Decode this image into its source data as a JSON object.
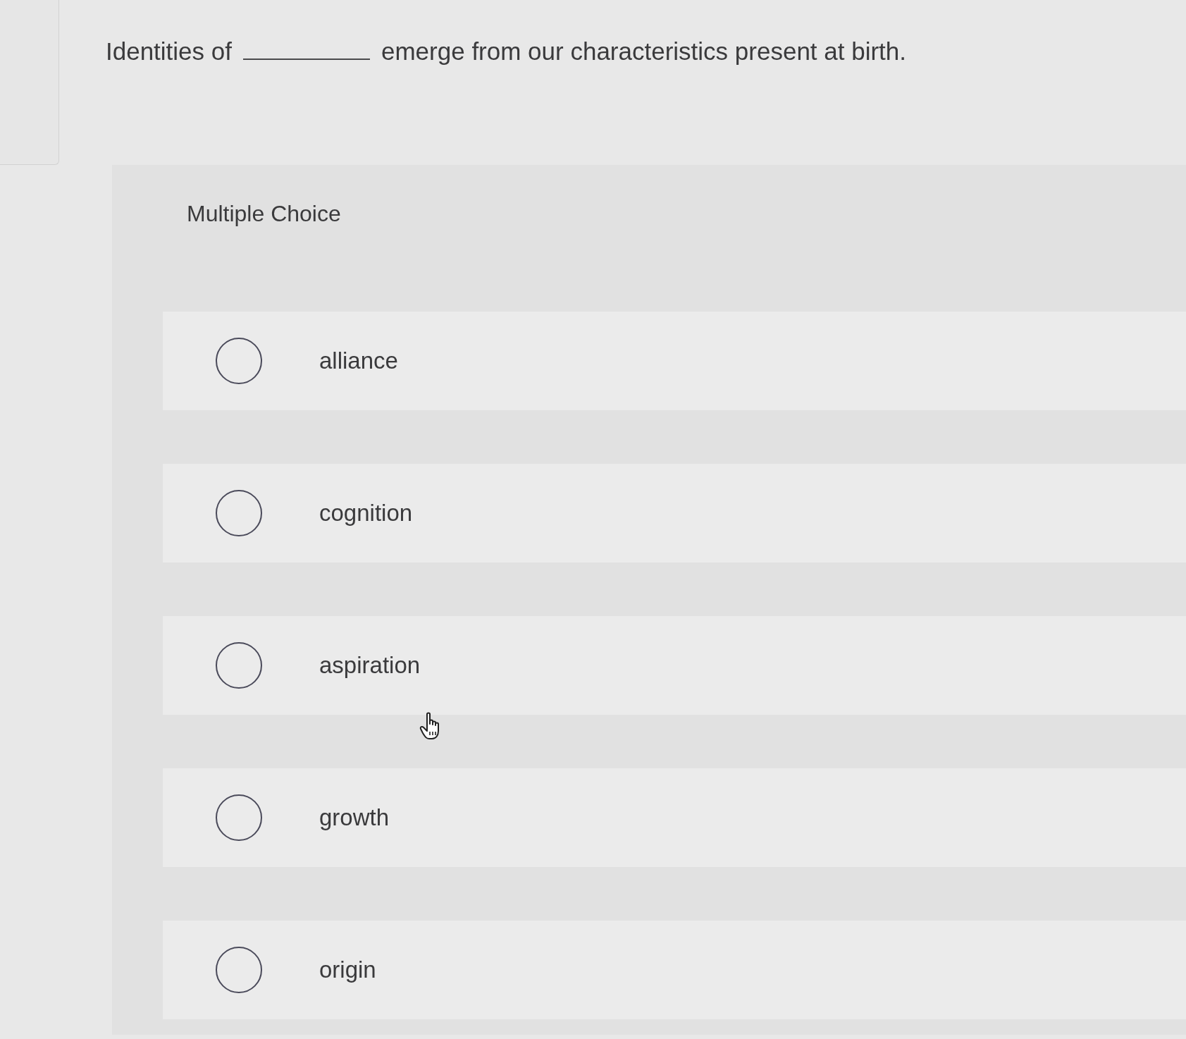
{
  "question": {
    "parts": [
      {
        "kind": "text",
        "text": "Identities of"
      },
      {
        "kind": "blank"
      },
      {
        "kind": "text",
        "text": "emerge from our characteristics present at birth."
      }
    ]
  },
  "choice_panel": {
    "title": "Multiple Choice",
    "options": [
      {
        "label": "alliance",
        "selected": false
      },
      {
        "label": "cognition",
        "selected": false
      },
      {
        "label": "aspiration",
        "selected": false
      },
      {
        "label": "growth",
        "selected": false
      },
      {
        "label": "origin",
        "selected": false
      }
    ]
  }
}
